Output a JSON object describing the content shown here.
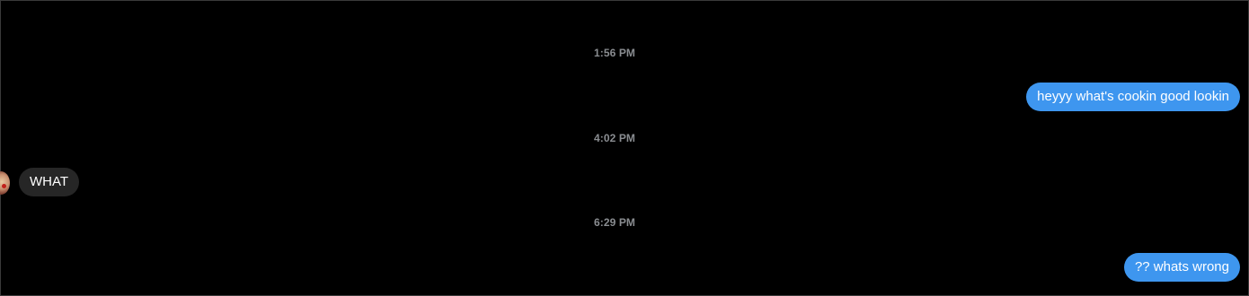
{
  "conversation": {
    "messages": [
      {
        "timestamp": "1:56 PM",
        "text": "heyyy what's cookin good lookin",
        "direction": "sent"
      },
      {
        "timestamp": "4:02 PM",
        "text": "WHAT",
        "direction": "received"
      },
      {
        "timestamp": "6:29 PM",
        "text": "?? whats wrong",
        "direction": "sent"
      }
    ]
  },
  "colors": {
    "background": "#000000",
    "sent_bubble": "#3e96ef",
    "received_bubble": "#262626",
    "timestamp_text": "#8a8d91"
  },
  "icons": {
    "contact_avatar": "profile-photo"
  }
}
